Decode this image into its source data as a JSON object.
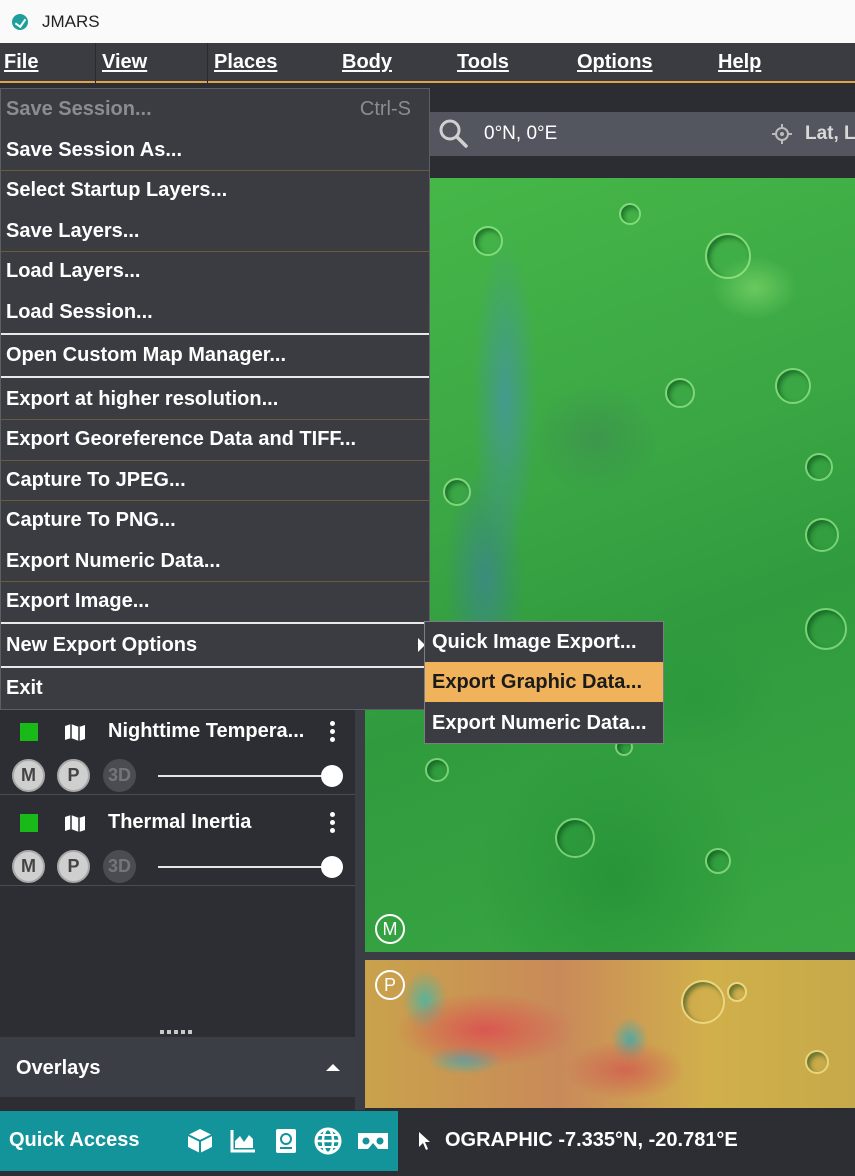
{
  "window": {
    "title": "JMARS"
  },
  "menubar": {
    "items": [
      "File",
      "View",
      "Places",
      "Body",
      "Tools",
      "Options",
      "Help"
    ]
  },
  "search": {
    "coords": "0°N, 0°E",
    "latlon_label": "Lat, L"
  },
  "file_menu": {
    "items": [
      {
        "label": "Save Session...",
        "shortcut": "Ctrl-S",
        "enabled": false
      },
      {
        "label": "Save Session As..."
      },
      {
        "label": "Select Startup Layers..."
      },
      {
        "label": "Save Layers..."
      },
      {
        "label": "Load Layers..."
      },
      {
        "label": "Load Session..."
      },
      {
        "label": "Open Custom Map Manager..."
      },
      {
        "label": "Export at higher resolution..."
      },
      {
        "label": "Export Georeference Data and TIFF..."
      },
      {
        "label": "Capture To JPEG..."
      },
      {
        "label": "Capture To PNG..."
      },
      {
        "label": "Export Numeric Data..."
      },
      {
        "label": "Export Image..."
      },
      {
        "label": "New Export Options"
      },
      {
        "label": "Exit"
      }
    ]
  },
  "submenu": {
    "items": [
      "Quick Image Export...",
      "Export Graphic Data...",
      "Export Numeric Data..."
    ],
    "active_index": 1
  },
  "layers": [
    {
      "name": "Nighttime Tempera...",
      "buttons": [
        "M",
        "P",
        "3D"
      ],
      "opacity": 1.0
    },
    {
      "name": "Thermal Inertia",
      "buttons": [
        "M",
        "P",
        "3D"
      ],
      "opacity": 1.0
    }
  ],
  "overlays": {
    "label": "Overlays"
  },
  "map": {
    "main_badge": "M",
    "panner_badge": "P"
  },
  "status": {
    "quick_access_label": "Quick Access",
    "quick_icons": [
      "cube-icon",
      "chart-icon",
      "book-icon",
      "globe-icon",
      "vr-headset-icon"
    ],
    "coords": "OGRAPHIC  -7.335°N, -20.781°E"
  },
  "colors": {
    "accent": "#e2a24a",
    "highlight": "#f0b25a",
    "quick_access": "#13939a",
    "layer_visible": "#18b918"
  }
}
